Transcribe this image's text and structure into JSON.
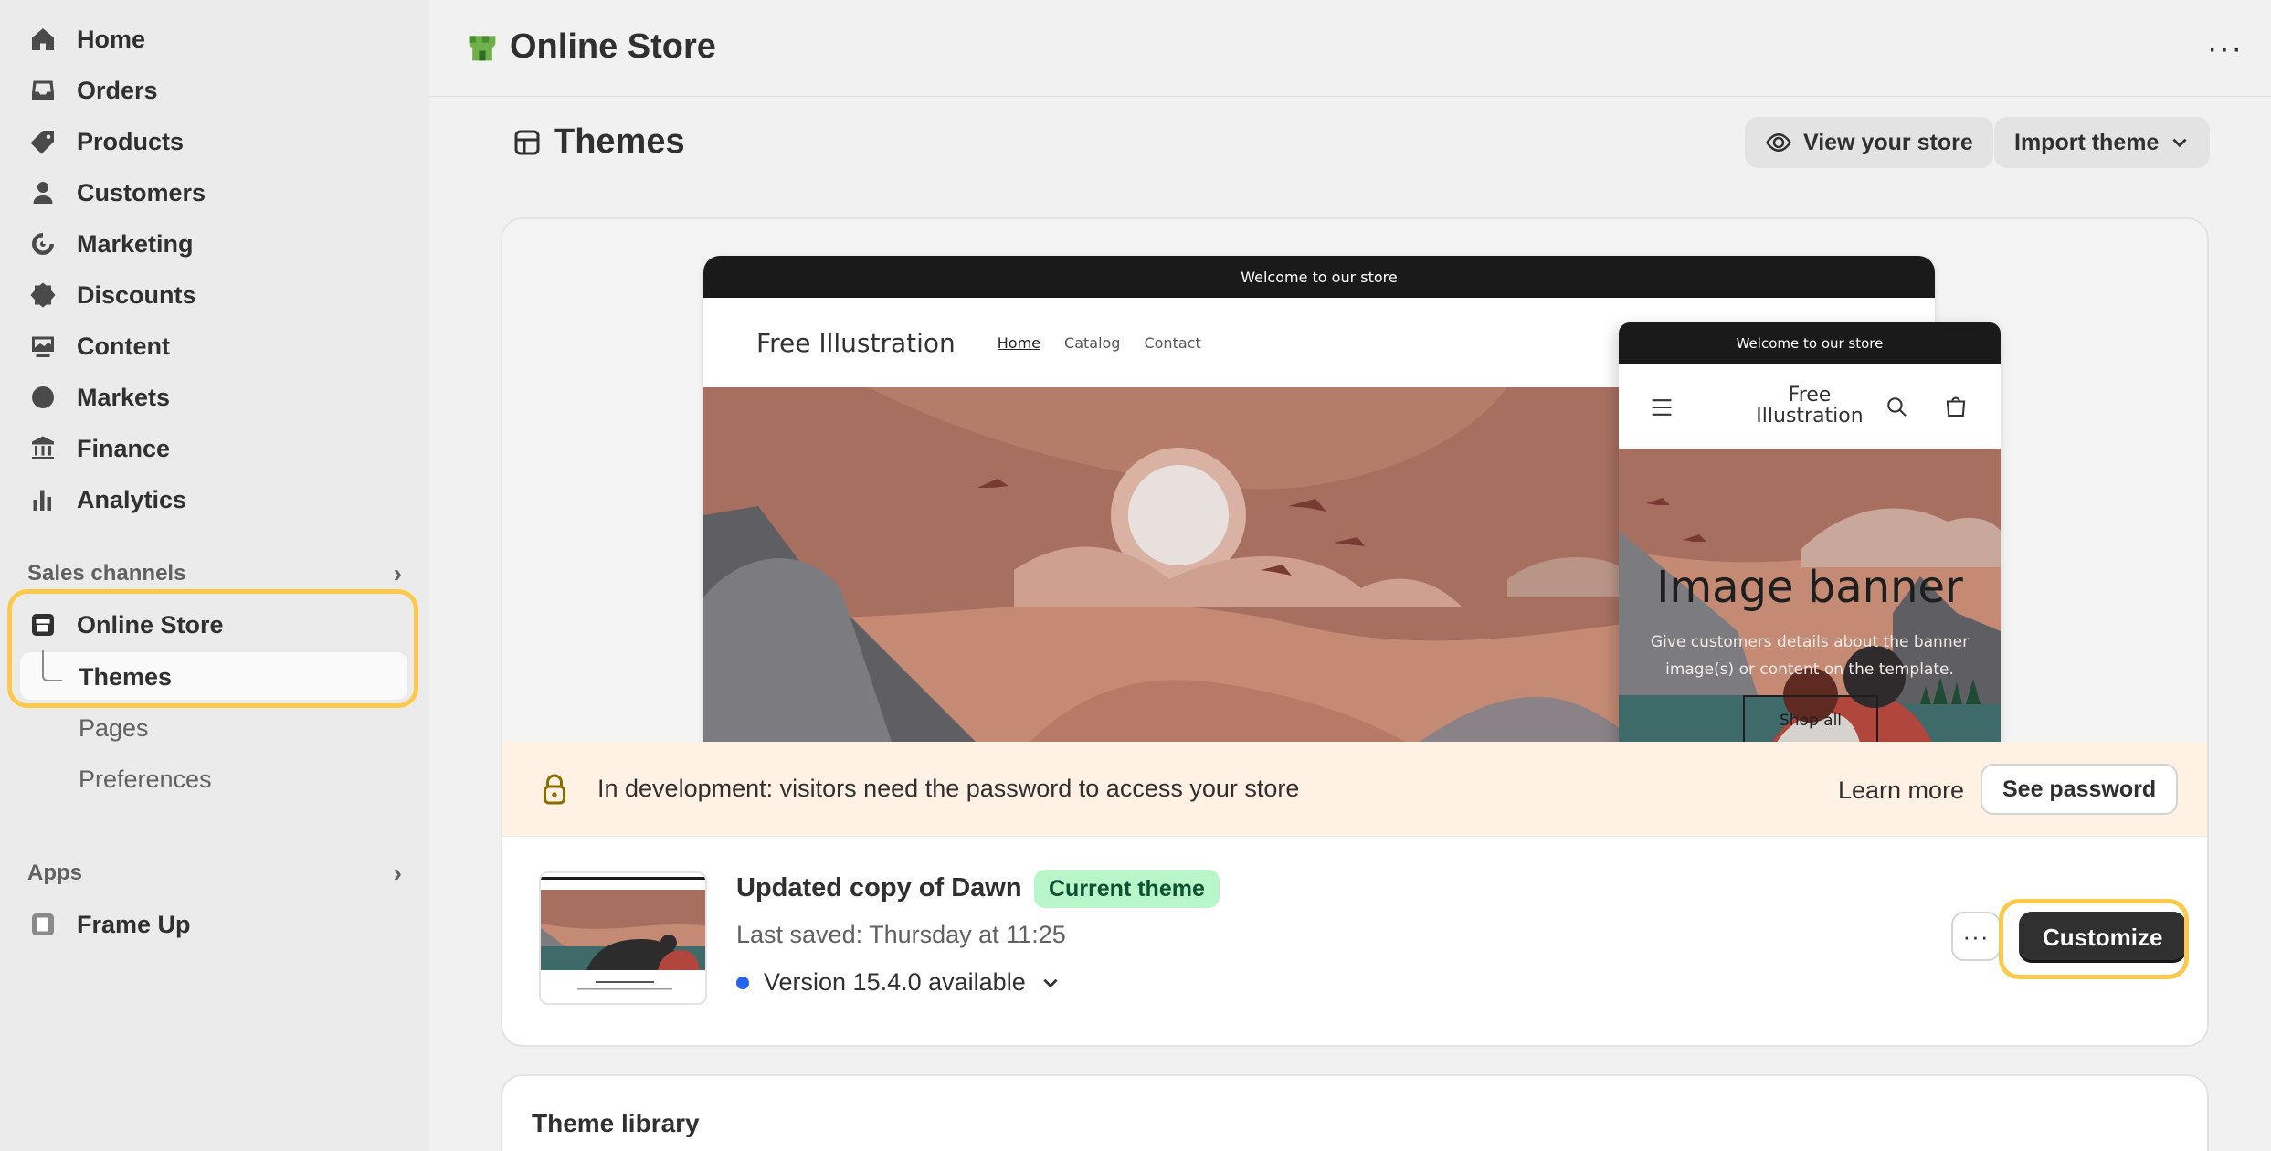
{
  "sidebar": {
    "items": [
      {
        "label": "Home",
        "icon": "home-icon"
      },
      {
        "label": "Orders",
        "icon": "inbox-icon"
      },
      {
        "label": "Products",
        "icon": "tag-icon"
      },
      {
        "label": "Customers",
        "icon": "person-icon"
      },
      {
        "label": "Marketing",
        "icon": "target-icon"
      },
      {
        "label": "Discounts",
        "icon": "discount-icon"
      },
      {
        "label": "Content",
        "icon": "image-icon"
      },
      {
        "label": "Markets",
        "icon": "globe-icon"
      },
      {
        "label": "Finance",
        "icon": "bank-icon"
      },
      {
        "label": "Analytics",
        "icon": "bar-chart-icon"
      }
    ],
    "sales_channels_label": "Sales channels",
    "online_store_label": "Online Store",
    "sub_items": [
      "Themes",
      "Pages",
      "Preferences"
    ],
    "apps_label": "Apps",
    "frame_up_label": "Frame Up"
  },
  "header": {
    "title": "Online Store",
    "more_label": "···"
  },
  "page": {
    "title": "Themes",
    "view_store_label": "View your store",
    "import_theme_label": "Import theme"
  },
  "preview": {
    "desktop": {
      "announcement": "Welcome to our store",
      "brand": "Free Illustration",
      "links": [
        "Home",
        "Catalog",
        "Contact"
      ]
    },
    "mobile": {
      "announcement": "Welcome to our store",
      "brand": "Free Illustration",
      "banner_title": "Image banner",
      "banner_text_1": "Give customers details about the banner",
      "banner_text_2": "image(s) or content on the template.",
      "banner_button": "Shop all"
    }
  },
  "dev_banner": {
    "message": "In development: visitors need the password to access your store",
    "learn_more": "Learn more",
    "see_password": "See password"
  },
  "current_theme": {
    "name": "Updated copy of Dawn",
    "badge": "Current theme",
    "last_saved": "Last saved: Thursday at 11:25",
    "version": "Version 15.4.0 available",
    "more_label": "···",
    "customize_label": "Customize"
  },
  "theme_library": {
    "title": "Theme library"
  },
  "colors": {
    "highlight": "#fcc94a",
    "badge_bg": "#b8f5c8",
    "dev_bg": "#fff1e3",
    "dot_blue": "#2463eb"
  }
}
